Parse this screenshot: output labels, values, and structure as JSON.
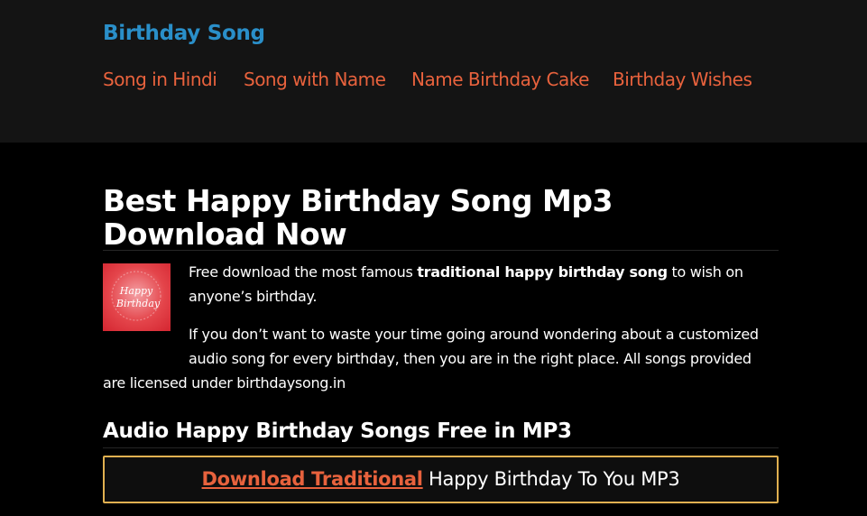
{
  "header": {
    "site_title": "Birthday Song",
    "nav": [
      {
        "label": "Song in Hindi"
      },
      {
        "label": "Song with Name"
      },
      {
        "label": "Name Birthday Cake"
      },
      {
        "label": "Birthday Wishes"
      }
    ]
  },
  "main": {
    "title": "Best Happy Birthday Song Mp3 Download Now",
    "thumbnail": {
      "line1": "Happy",
      "line2": "Birthday"
    },
    "intro": {
      "before": "Free download the most famous ",
      "bold": "traditional happy birthday song",
      "after": " to wish on anyone’s birthday."
    },
    "body_lines": [
      "If you don’t want to waste your time going around wondering about a customized",
      "audio song for every birthday, then you are in the right place. All songs provided",
      "are licensed under birthdaysong.in"
    ],
    "section_heading": "Audio Happy Birthday Songs Free in MP3",
    "download": {
      "link_text": "Download Traditional",
      "rest_text": " Happy Birthday To You MP3"
    }
  },
  "colors": {
    "header_bg": "#141414",
    "page_bg": "#000000",
    "site_title": "#2a8fc9",
    "nav_link": "#e8623d",
    "box_border": "#e0b050"
  }
}
